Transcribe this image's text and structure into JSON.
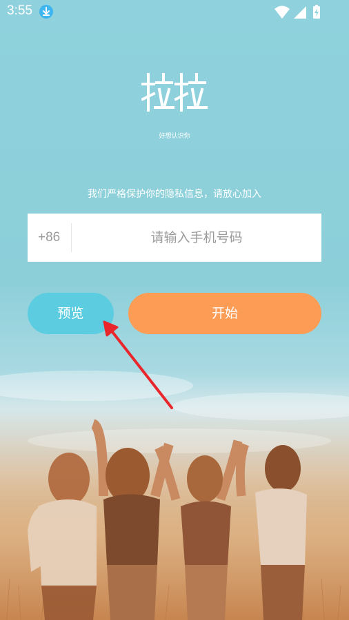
{
  "status_bar": {
    "time": "3:55",
    "icons": [
      "download-icon",
      "wifi-icon",
      "signal-icon",
      "battery-charging-icon"
    ]
  },
  "logo": {
    "text": "拉拉",
    "tagline": "好想认识你"
  },
  "privacy_notice": "我们严格保护你的隐私信息，请放心加入",
  "phone_form": {
    "country_code": "+86",
    "placeholder": "请输入手机号码",
    "value": ""
  },
  "buttons": {
    "preview_label": "预览",
    "start_label": "开始"
  },
  "colors": {
    "background_top": "#8fd2dd",
    "preview_button": "#5ccde0",
    "start_button": "#fd9c55",
    "annotation_arrow": "#e8262b"
  }
}
